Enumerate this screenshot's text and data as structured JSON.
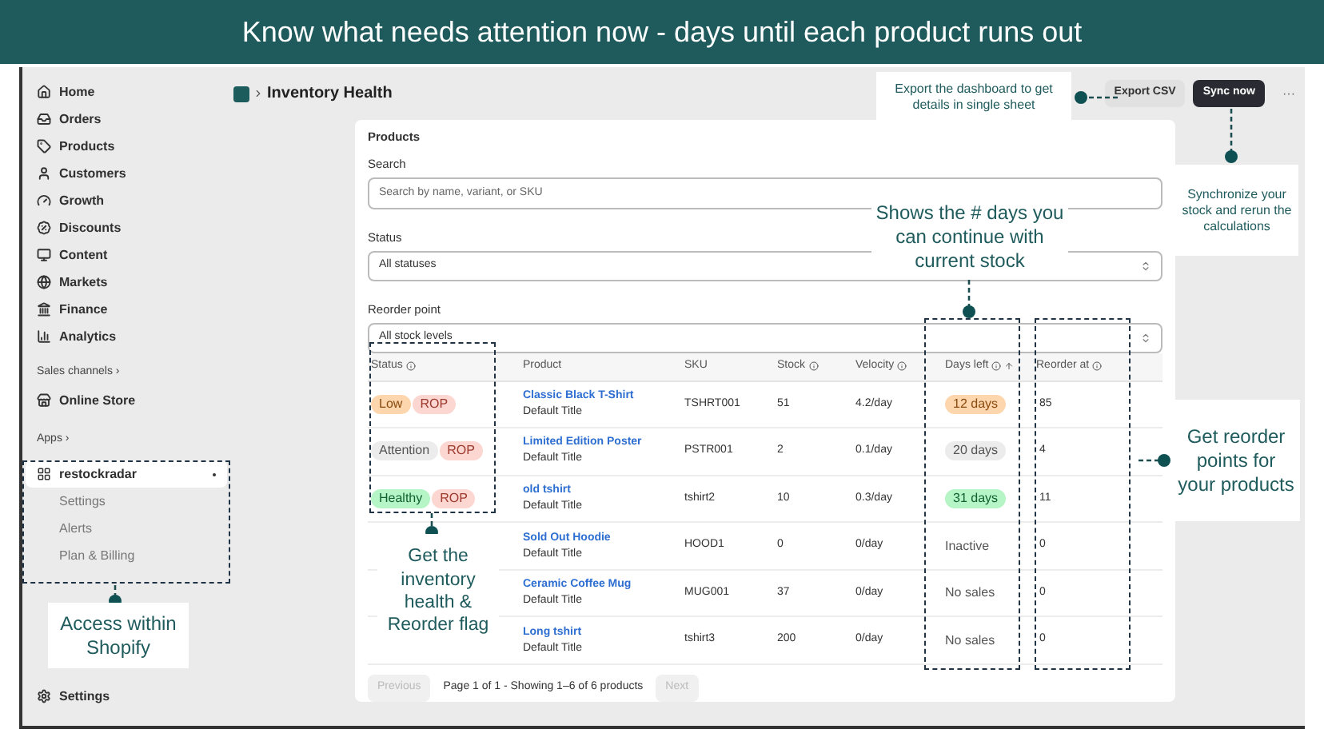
{
  "banner": {
    "title": "Know what needs attention now - days until each product runs out"
  },
  "sidebar": {
    "items": [
      {
        "label": "Home",
        "selected": false
      },
      {
        "label": "Orders",
        "selected": false
      },
      {
        "label": "Products",
        "selected": false
      },
      {
        "label": "Customers",
        "selected": false
      },
      {
        "label": "Growth",
        "selected": false
      },
      {
        "label": "Discounts",
        "selected": false
      },
      {
        "label": "Content",
        "selected": false
      },
      {
        "label": "Markets",
        "selected": false
      },
      {
        "label": "Finance",
        "selected": false
      },
      {
        "label": "Analytics",
        "selected": false
      }
    ],
    "sales_channels_label": "Sales channels ›",
    "sales_channels": [
      {
        "label": "Online Store",
        "selected": false
      }
    ],
    "apps_label": "Apps ›",
    "apps": [
      {
        "label": "restockradar",
        "selected": true,
        "subitems": [
          "Settings",
          "Alerts",
          "Plan & Billing"
        ]
      }
    ],
    "footer": "Settings"
  },
  "header": {
    "title": "Inventory Health",
    "buttons": [
      {
        "label": "Export CSV",
        "kind": "secondary"
      },
      {
        "label": "Sync now",
        "kind": "primary"
      }
    ],
    "more": "···"
  },
  "card": {
    "title": "Products",
    "search": {
      "label": "Search",
      "placeholder": "Search by name, variant, or SKU"
    },
    "status_filter": {
      "label": "Status",
      "value": "All statuses"
    },
    "reorder_filter": {
      "label": "Reorder point",
      "value": "All stock levels"
    }
  },
  "table": {
    "columns": [
      {
        "label": "Status",
        "info": true,
        "sorted": false
      },
      {
        "label": "Product",
        "info": false,
        "sorted": false
      },
      {
        "label": "SKU",
        "info": false,
        "sorted": false
      },
      {
        "label": "Stock",
        "info": true,
        "sorted": false
      },
      {
        "label": "Velocity",
        "info": true,
        "sorted": false
      },
      {
        "label": "Days left",
        "info": true,
        "sorted": true
      },
      {
        "label": "Reorder at",
        "info": true,
        "sorted": false
      }
    ],
    "rows": [
      {
        "status": [
          {
            "label": "Low",
            "kind": "warning"
          },
          {
            "label": "ROP",
            "kind": "critical"
          }
        ],
        "product": "Classic Black T-Shirt",
        "variant": "Default Title",
        "sku": "TSHRT001",
        "stock": "51",
        "velocity": "4.2/day",
        "days_left": {
          "text": "12 days",
          "kind": "warning"
        },
        "reorder_at": "85"
      },
      {
        "status": [
          {
            "label": "Attention",
            "kind": "neutral"
          },
          {
            "label": "ROP",
            "kind": "critical"
          }
        ],
        "product": "Limited Edition Poster",
        "variant": "Default Title",
        "sku": "PSTR001",
        "stock": "2",
        "velocity": "0.1/day",
        "days_left": {
          "text": "20 days",
          "kind": "neutral"
        },
        "reorder_at": "4"
      },
      {
        "status": [
          {
            "label": "Healthy",
            "kind": "success"
          },
          {
            "label": "ROP",
            "kind": "critical"
          }
        ],
        "product": "old tshirt",
        "variant": "Default Title",
        "sku": "tshirt2",
        "stock": "10",
        "velocity": "0.3/day",
        "days_left": {
          "text": "31 days",
          "kind": "success"
        },
        "reorder_at": "11"
      },
      {
        "status": [],
        "product": "Sold Out Hoodie",
        "variant": "Default Title",
        "sku": "HOOD1",
        "stock": "0",
        "velocity": "0/day",
        "days_left": {
          "text": "Inactive",
          "kind": "plain"
        },
        "reorder_at": "0"
      },
      {
        "status": [],
        "product": "Ceramic Coffee Mug",
        "variant": "Default Title",
        "sku": "MUG001",
        "stock": "37",
        "velocity": "0/day",
        "days_left": {
          "text": "No sales",
          "kind": "plain"
        },
        "reorder_at": "0"
      },
      {
        "status": [],
        "product": "Long tshirt",
        "variant": "Default Title",
        "sku": "tshirt3",
        "stock": "200",
        "velocity": "0/day",
        "days_left": {
          "text": "No sales",
          "kind": "plain"
        },
        "reorder_at": "0"
      }
    ]
  },
  "pagination": {
    "previous": {
      "label": "Previous",
      "disabled": true
    },
    "summary": "Page 1 of 1 - Showing 1–6 of 6 products",
    "next": {
      "label": "Next",
      "disabled": true
    }
  },
  "annotations": [
    {
      "text": "Export the dashboard to get details in single sheet"
    },
    {
      "text": "Synchronize your stock and rerun the calculations"
    },
    {
      "text": "Shows the # days you can continue with current stock"
    },
    {
      "text": "Get reorder points for your products"
    },
    {
      "text": "Access within Shopify"
    },
    {
      "text": "Get the inventory health & Reorder flag"
    }
  ]
}
